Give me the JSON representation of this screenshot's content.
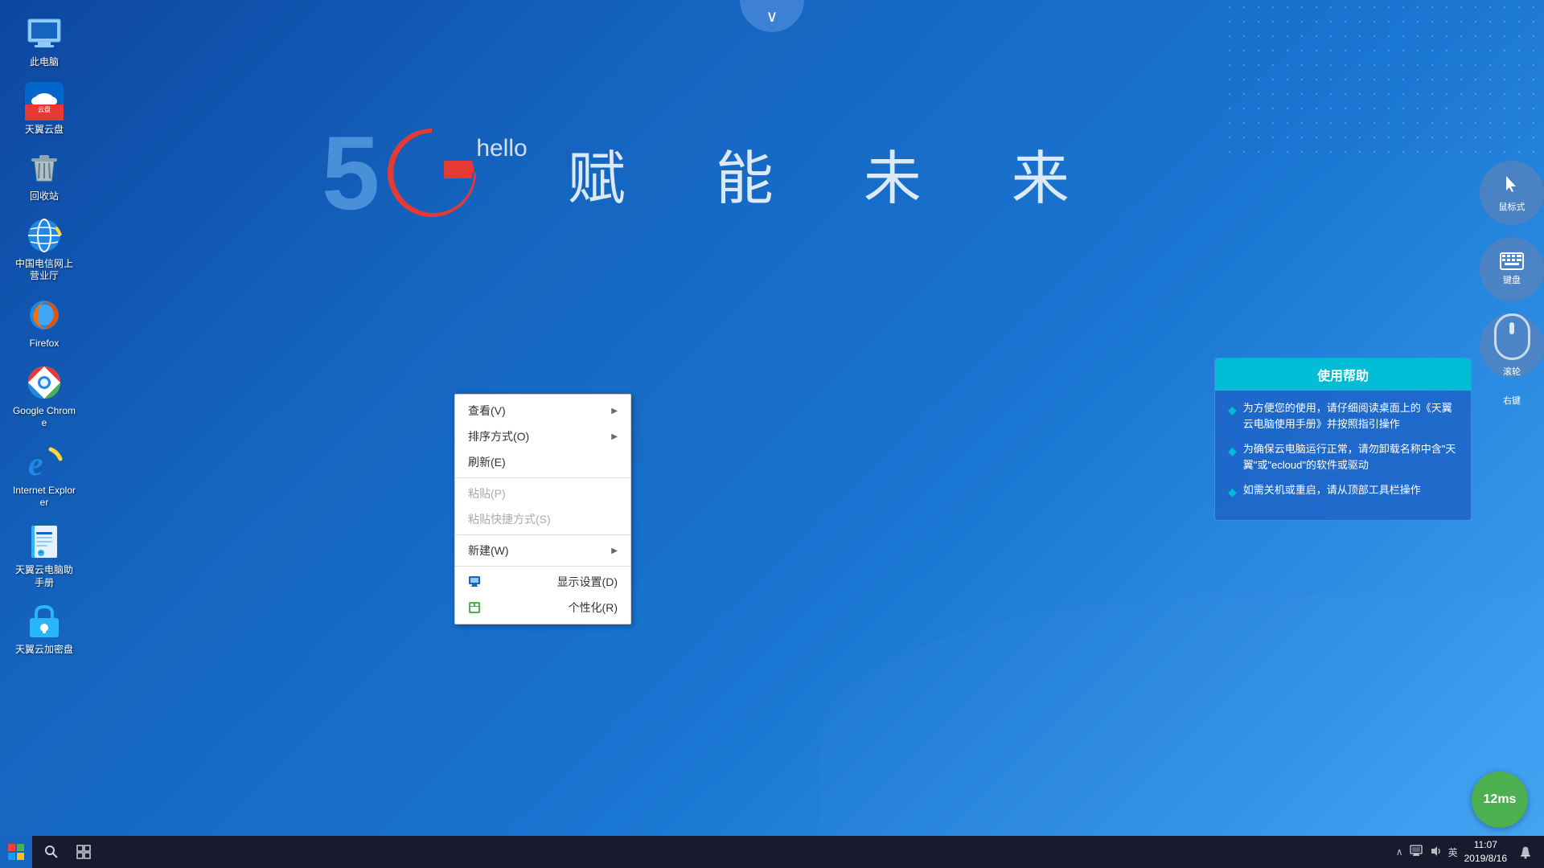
{
  "desktop": {
    "background_color": "#1565c0",
    "hero": {
      "number": "5",
      "letter": "G",
      "sub": "hello",
      "tagline": "赋　能　未　来"
    }
  },
  "icons": [
    {
      "id": "computer",
      "label": "此电脑",
      "type": "computer"
    },
    {
      "id": "cloud-disk",
      "label": "天翼云盘",
      "type": "cloud"
    },
    {
      "id": "recycle",
      "label": "回收站",
      "type": "recycle"
    },
    {
      "id": "telecom",
      "label": "中国电信网上营业厅",
      "type": "ie"
    },
    {
      "id": "firefox",
      "label": "Firefox",
      "type": "firefox"
    },
    {
      "id": "chrome",
      "label": "Google Chrome",
      "type": "chrome"
    },
    {
      "id": "ie",
      "label": "Internet Explorer",
      "type": "ie2"
    },
    {
      "id": "manual",
      "label": "天翼云电脑助手册",
      "type": "manual"
    },
    {
      "id": "encrypt",
      "label": "天翼云加密盘",
      "type": "encrypt"
    }
  ],
  "context_menu": {
    "items": [
      {
        "id": "view",
        "label": "查看(V)",
        "has_arrow": true,
        "disabled": false
      },
      {
        "id": "sort",
        "label": "排序方式(O)",
        "has_arrow": true,
        "disabled": false
      },
      {
        "id": "refresh",
        "label": "刷新(E)",
        "has_arrow": false,
        "disabled": false
      },
      {
        "separator": true
      },
      {
        "id": "paste",
        "label": "粘贴(P)",
        "has_arrow": false,
        "disabled": true
      },
      {
        "id": "paste-shortcut",
        "label": "粘贴快捷方式(S)",
        "has_arrow": false,
        "disabled": true
      },
      {
        "separator": true
      },
      {
        "id": "new",
        "label": "新建(W)",
        "has_arrow": true,
        "disabled": false
      },
      {
        "separator": true
      },
      {
        "id": "display",
        "label": "显示设置(D)",
        "has_arrow": false,
        "disabled": false,
        "has_icon": true,
        "icon_color": "#1565c0"
      },
      {
        "id": "personalize",
        "label": "个性化(R)",
        "has_arrow": false,
        "disabled": false,
        "has_icon": true,
        "icon_color": "#4caf50"
      }
    ]
  },
  "right_controls": [
    {
      "id": "mouse",
      "label": "鼠标式",
      "icon": "🖱"
    },
    {
      "id": "keyboard",
      "label": "键盘",
      "icon": "⌨"
    },
    {
      "id": "scroll",
      "label": "滚轮",
      "icon": "scroll"
    }
  ],
  "help_panel": {
    "title": "使用帮助",
    "items": [
      "为方便您的使用，请仔细阅读桌面上的《天翼云电脑使用手册》并按照指引操作",
      "为确保云电脑运行正常，请勿卸载名称中含\"天翼\"或\"ecloud\"的软件或驱动",
      "如需关机或重启，请从顶部工具栏操作"
    ]
  },
  "right_click_label": "右键",
  "ping": {
    "value": "12ms"
  },
  "taskbar": {
    "start_icon": "⊞",
    "search_icon": "🔍",
    "view_icon": "⬜",
    "tray": {
      "chevron": "∧",
      "network_icon": "🖥",
      "volume_icon": "🔊",
      "lang": "英",
      "time": "11:07",
      "date": "2019/8/16",
      "notify_icon": "💬"
    }
  },
  "top_chevron": "∨"
}
